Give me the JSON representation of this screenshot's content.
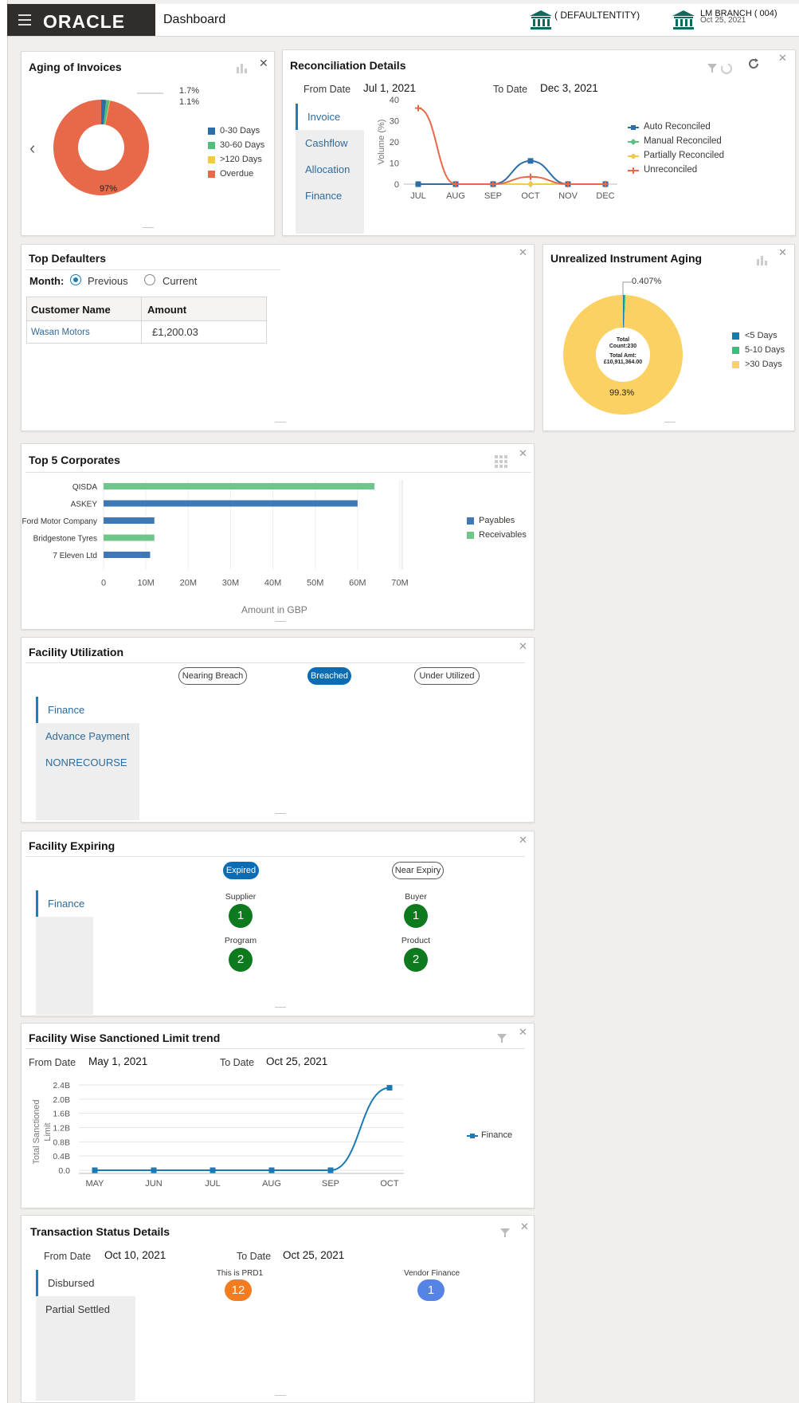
{
  "header": {
    "logo": "ORACLE",
    "title": "Dashboard",
    "entity": "( DEFAULTENTITY)",
    "branch": "LM BRANCH  ( 004)",
    "date": "Oct 25, 2021"
  },
  "aging_invoices": {
    "title": "Aging of Invoices",
    "labels": [
      "1.7%",
      "1.1%",
      "97%"
    ],
    "legend": [
      "0-30 Days",
      "30-60 Days",
      ">120 Days",
      "Overdue"
    ],
    "colors": [
      "#2e6ea6",
      "#4fbf7a",
      "#f2c94c",
      "#e8694a"
    ],
    "slices": [
      1.7,
      1.1,
      0.2,
      97
    ]
  },
  "reconciliation": {
    "title": "Reconciliation Details",
    "from_label": "From Date",
    "from_value": "Jul 1, 2021",
    "to_label": "To Date",
    "to_value": "Dec 3, 2021",
    "tabs": [
      "Invoice",
      "Cashflow",
      "Allocation",
      "Finance"
    ],
    "ylabel": "Volume (%)",
    "legend": [
      "Auto Reconciled",
      "Manual Reconciled",
      "Partially Reconciled",
      "Unreconciled"
    ]
  },
  "top_defaulters": {
    "title": "Top Defaulters",
    "month_label": "Month:",
    "options": [
      "Previous",
      "Current"
    ],
    "columns": [
      "Customer Name",
      "Amount"
    ],
    "rows": [
      {
        "name": "Wasan Motors",
        "amount": "£1,200.03"
      }
    ]
  },
  "unrealized": {
    "title": "Unrealized Instrument Aging",
    "top_label": "0.407%",
    "center_count_l1": "Total",
    "center_count_l2": "Count:230",
    "center_amt_l1": "Total Amt:",
    "center_amt_l2": "£10,911,364.00",
    "bottom_label": "99.3%",
    "legend": [
      "<5 Days",
      "5-10 Days",
      ">30 Days"
    ],
    "colors": [
      "#137eaa",
      "#35c07c",
      "#fcd163"
    ]
  },
  "top5": {
    "title": "Top 5 Corporates",
    "xlabel": "Amount in GBP",
    "legend": [
      "Payables",
      "Receivables"
    ]
  },
  "facility_util": {
    "title": "Facility Utilization",
    "pills": [
      "Nearing Breach",
      "Breached",
      "Under Utilized"
    ],
    "tabs": [
      "Finance",
      "Advance Payment",
      "NONRECOURSE"
    ]
  },
  "facility_exp": {
    "title": "Facility Expiring",
    "pills": [
      "Expired",
      "Near Expiry"
    ],
    "tabs": [
      "Finance"
    ],
    "items": [
      {
        "label": "Supplier",
        "value": "1"
      },
      {
        "label": "Buyer",
        "value": "1"
      },
      {
        "label": "Program",
        "value": "2"
      },
      {
        "label": "Product",
        "value": "2"
      }
    ]
  },
  "sanctioned": {
    "title": "Facility Wise Sanctioned Limit trend",
    "from_label": "From Date",
    "from_value": "May 1, 2021",
    "to_label": "To Date",
    "to_value": "Oct 25, 2021",
    "ylabel1": "Total Sanctioned",
    "ylabel2": "Limit",
    "legend": [
      "Finance"
    ]
  },
  "txn_status": {
    "title": "Transaction Status Details",
    "from_label": "From Date",
    "from_value": "Oct 10, 2021",
    "to_label": "To Date",
    "to_value": "Oct 25, 2021",
    "tabs": [
      "Disbursed",
      "Partial Settled"
    ],
    "items": [
      {
        "label": "This is PRD1",
        "value": "12",
        "color": "#f47c20"
      },
      {
        "label": "Vendor Finance",
        "value": "1",
        "color": "#5583e6"
      }
    ]
  },
  "chart_data": [
    {
      "type": "line",
      "title": "Reconciliation Details",
      "ylabel": "Volume (%)",
      "categories": [
        "JUL",
        "AUG",
        "SEP",
        "OCT",
        "NOV",
        "DEC"
      ],
      "ylim": [
        0,
        40
      ],
      "yticks": [
        0,
        10,
        20,
        30,
        40
      ],
      "series": [
        {
          "name": "Auto Reconciled",
          "color": "#2e6ea6",
          "values": [
            0,
            0,
            0,
            11,
            0,
            0
          ]
        },
        {
          "name": "Manual Reconciled",
          "color": "#5fbf7f",
          "values": [
            0,
            0,
            0,
            0,
            0,
            0
          ]
        },
        {
          "name": "Partially Reconciled",
          "color": "#f2c94c",
          "values": [
            0,
            0,
            0,
            0,
            0,
            0
          ]
        },
        {
          "name": "Unreconciled",
          "color": "#e8694a",
          "values": [
            36,
            0,
            0,
            3.5,
            0,
            0
          ]
        }
      ]
    },
    {
      "type": "bar",
      "title": "Top 5 Corporates",
      "xlabel": "Amount in GBP",
      "categories": [
        "QISDA",
        "ASKEY",
        "Ford Motor Company",
        "Bridgestone Tyres",
        "7 Eleven Ltd"
      ],
      "xlim": [
        0,
        70
      ],
      "xticks": [
        "0",
        "10M",
        "20M",
        "30M",
        "40M",
        "50M",
        "60M",
        "70M"
      ],
      "series": [
        {
          "name": "Payables",
          "color": "#3f78b5",
          "values": [
            0,
            60,
            12,
            0,
            11
          ]
        },
        {
          "name": "Receivables",
          "color": "#6fc68a",
          "values": [
            64,
            0,
            0,
            12,
            0
          ]
        }
      ]
    },
    {
      "type": "line",
      "title": "Facility Wise Sanctioned Limit trend",
      "categories": [
        "MAY",
        "JUN",
        "JUL",
        "AUG",
        "SEP",
        "OCT"
      ],
      "ylim": [
        0,
        2.4
      ],
      "yticks": [
        "0.0",
        "0.4B",
        "0.8B",
        "1.2B",
        "1.6B",
        "2.0B",
        "2.4B"
      ],
      "series": [
        {
          "name": "Finance",
          "color": "#1a7ab3",
          "values": [
            0,
            0,
            0,
            0,
            0,
            2.32
          ]
        }
      ]
    }
  ]
}
